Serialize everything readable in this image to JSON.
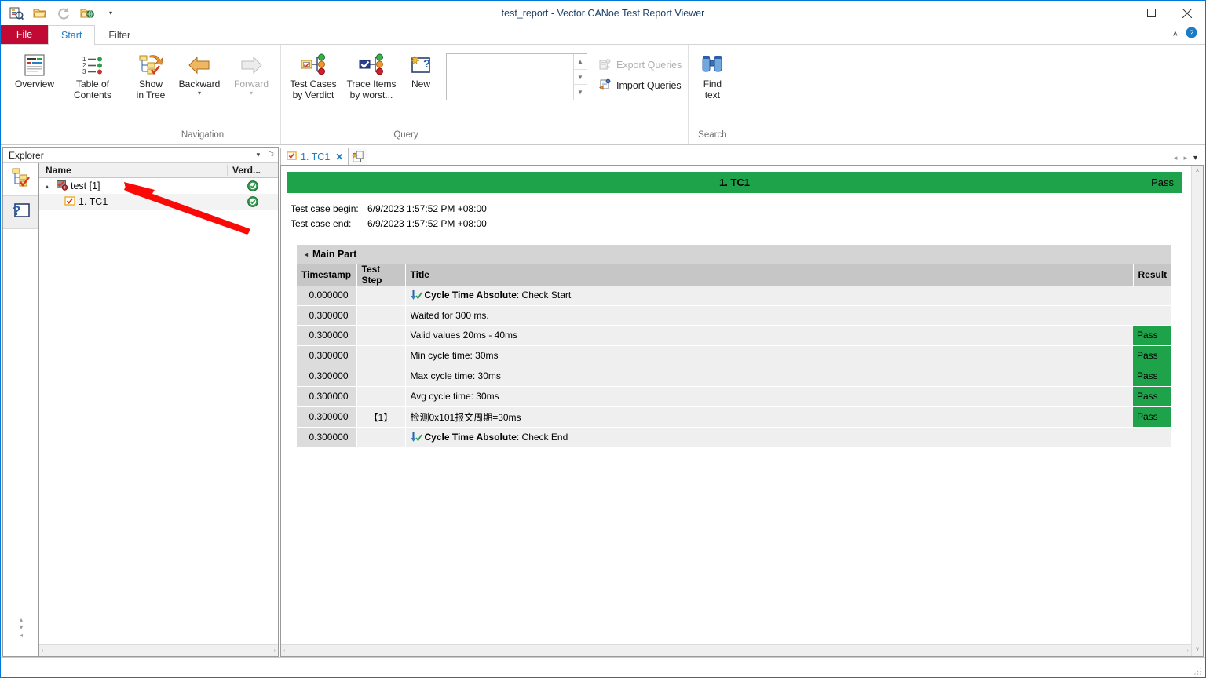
{
  "window": {
    "title": "test_report - Vector CANoe Test Report Viewer",
    "minimize_label": "—",
    "maximize_label": "□",
    "close_label": "✕"
  },
  "quick_access": [
    {
      "name": "open-report-icon",
      "label": "Open Report"
    },
    {
      "name": "open-folder-icon",
      "label": "Open"
    },
    {
      "name": "refresh-icon",
      "label": "Refresh"
    },
    {
      "name": "export-html-icon",
      "label": "Export"
    },
    {
      "name": "customize-qat-caret",
      "label": "▾"
    }
  ],
  "ribbon": {
    "tabs": [
      {
        "id": "file",
        "label": "File"
      },
      {
        "id": "start",
        "label": "Start"
      },
      {
        "id": "filter",
        "label": "Filter"
      }
    ],
    "active_tab": "start",
    "collapse_label": "˄",
    "help_label": "?",
    "groups": [
      {
        "name": "overview-group",
        "label": "",
        "buttons": [
          {
            "name": "overview-button",
            "label": "Overview",
            "icon": "report-overview-icon",
            "disabled": false,
            "caret": false
          },
          {
            "name": "table-of-contents-button",
            "label": "Table of\nContents",
            "line1": "Table of",
            "line2": "Contents",
            "icon": "toc-icon",
            "disabled": false,
            "caret": false
          }
        ]
      },
      {
        "name": "navigation-group",
        "label": "Navigation",
        "buttons": [
          {
            "name": "show-in-tree-button",
            "line1": "Show",
            "line2": "in Tree",
            "icon": "show-in-tree-icon",
            "disabled": false,
            "caret": false
          },
          {
            "name": "backward-button",
            "line1": "Backward",
            "line2": "",
            "icon": "arrow-left-icon",
            "disabled": false,
            "caret": true
          },
          {
            "name": "forward-button",
            "line1": "Forward",
            "line2": "",
            "icon": "arrow-right-icon",
            "disabled": true,
            "caret": true
          }
        ]
      },
      {
        "name": "query-group",
        "label": "Query",
        "buttons": [
          {
            "name": "test-cases-by-verdict-button",
            "line1": "Test Cases",
            "line2": "by Verdict",
            "icon": "test-cases-verdict-icon",
            "disabled": false,
            "caret": false
          },
          {
            "name": "trace-items-by-worst-button",
            "line1": "Trace Items",
            "line2": "by worst...",
            "icon": "trace-items-icon",
            "disabled": false,
            "caret": false
          },
          {
            "name": "new-query-button",
            "line1": "New",
            "line2": "",
            "icon": "new-query-icon",
            "disabled": false,
            "caret": false
          }
        ],
        "query_list": {
          "name": "query-list",
          "value": "",
          "placeholder": ""
        },
        "commands": [
          {
            "name": "export-queries-button",
            "label": "Export Queries",
            "icon": "export-queries-icon",
            "disabled": true
          },
          {
            "name": "import-queries-button",
            "label": "Import Queries",
            "icon": "import-queries-icon",
            "disabled": false
          }
        ]
      },
      {
        "name": "search-group",
        "label": "Search",
        "buttons": [
          {
            "name": "find-text-button",
            "line1": "Find",
            "line2": "text",
            "icon": "binoculars-icon",
            "disabled": false,
            "caret": false
          }
        ]
      }
    ]
  },
  "explorer": {
    "title": "Explorer",
    "dropdown_label": "▾",
    "pin_label": "⚐",
    "side_tabs": [
      {
        "name": "explorer-tab-tree",
        "icon": "tree-structure-icon",
        "active": false
      },
      {
        "name": "explorer-tab-help",
        "icon": "question-box-icon",
        "active": true
      }
    ],
    "columns": [
      {
        "key": "name",
        "label": "Name"
      },
      {
        "key": "verdict",
        "label": "Verd..."
      }
    ],
    "rows": [
      {
        "name": "test [1]",
        "indent": 1,
        "expander": "▴",
        "icon": "test-module-icon",
        "verdict": "pass",
        "selected": false
      },
      {
        "name": "1. TC1",
        "indent": 2,
        "expander": "",
        "icon": "test-case-icon",
        "verdict": "pass",
        "selected": true
      }
    ],
    "scroll_left_label": "‹",
    "scroll_right_label": "›",
    "spin_up_label": "▴",
    "spin_down_label": "▾",
    "spin_end_label": "◂"
  },
  "document": {
    "tabs": [
      {
        "name": "doc-tab-tc1",
        "label": "1. TC1",
        "icon": "test-case-icon",
        "close_label": "✕",
        "active": true
      }
    ],
    "add_tab": {
      "name": "doc-tab-overview",
      "icon": "report-overview-icon"
    },
    "nav": {
      "prev_label": "◂",
      "next_label": "▸",
      "list_label": "▾"
    },
    "verdict_banner": {
      "title": "1. TC1",
      "result": "Pass",
      "color": "#1fa34a"
    },
    "meta": [
      {
        "label": "Test case begin:",
        "value": "6/9/2023 1:57:52 PM +08:00"
      },
      {
        "label": "Test case end:",
        "value": "6/9/2023 1:57:52 PM +08:00"
      }
    ],
    "main_part": {
      "title": "Main Part",
      "collapse_label": "◢",
      "columns": [
        {
          "key": "timestamp",
          "label": "Timestamp"
        },
        {
          "key": "teststep",
          "label": "Test Step"
        },
        {
          "key": "title",
          "label": "Title"
        },
        {
          "key": "result",
          "label": "Result"
        }
      ],
      "rows": [
        {
          "timestamp": "0.000000",
          "teststep": "",
          "icon": "cycle-time-check-icon",
          "title_bold": "Cycle Time Absolute",
          "title_rest": ": Check Start",
          "result": ""
        },
        {
          "timestamp": "0.300000",
          "teststep": "",
          "icon": "",
          "title_bold": "",
          "title_rest": "Waited for 300 ms.",
          "result": ""
        },
        {
          "timestamp": "0.300000",
          "teststep": "",
          "icon": "",
          "title_bold": "",
          "title_rest": "Valid values 20ms - 40ms",
          "result": "Pass"
        },
        {
          "timestamp": "0.300000",
          "teststep": "",
          "icon": "",
          "title_bold": "",
          "title_rest": "Min cycle time: 30ms",
          "result": "Pass"
        },
        {
          "timestamp": "0.300000",
          "teststep": "",
          "icon": "",
          "title_bold": "",
          "title_rest": "Max cycle time: 30ms",
          "result": "Pass"
        },
        {
          "timestamp": "0.300000",
          "teststep": "",
          "icon": "",
          "title_bold": "",
          "title_rest": "Avg cycle time: 30ms",
          "result": "Pass"
        },
        {
          "timestamp": "0.300000",
          "teststep": "【1】",
          "icon": "",
          "title_bold": "",
          "title_rest": "检测0x101报文周期=30ms",
          "result": "Pass"
        },
        {
          "timestamp": "0.300000",
          "teststep": "",
          "icon": "cycle-time-check-icon",
          "title_bold": "Cycle Time Absolute",
          "title_rest": ": Check End",
          "result": ""
        }
      ]
    },
    "hscroll": {
      "left_label": "‹",
      "right_label": "›"
    },
    "vscroll": {
      "up_label": "˄",
      "down_label": "˅"
    }
  },
  "annotation": {
    "name": "red-arrow-annotation",
    "color": "#fa0a06",
    "points": "tip at test case row, tail lower-right"
  },
  "colors": {
    "accent_blue": "#0078d7",
    "file_tab_red": "#c00a33",
    "pass_green": "#1fa34a",
    "tab_active_text": "#1a7dc4"
  }
}
